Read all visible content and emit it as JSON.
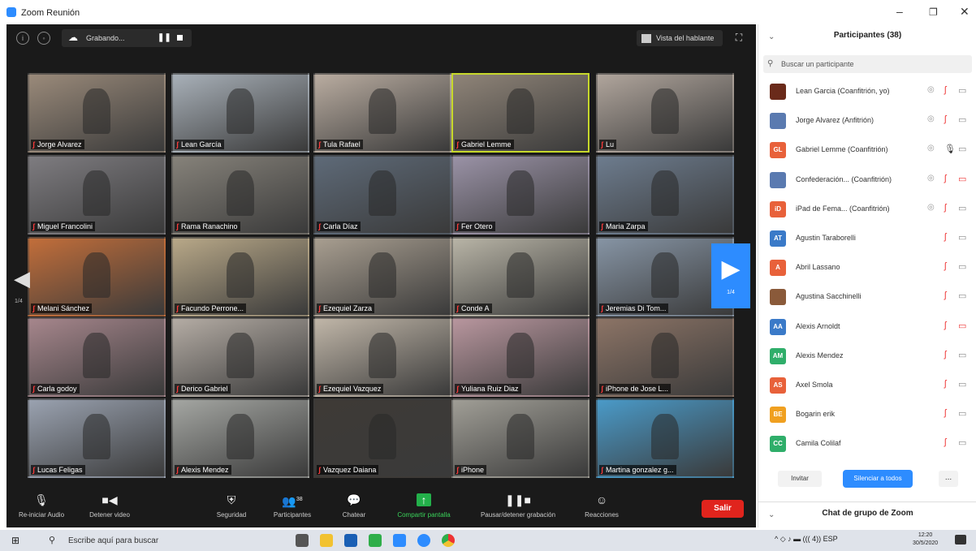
{
  "window": {
    "title": "Zoom Reunión",
    "controls": [
      "–",
      "❐",
      "✕"
    ]
  },
  "topbar": {
    "recording_label": "Grabando...",
    "speaker_view_label": "Vista del hablante"
  },
  "grid": {
    "page_left": "1/4",
    "page_right": "1/4",
    "tiles": [
      {
        "name": "Jorge Alvarez",
        "bg": "#9a8a7a",
        "active": false
      },
      {
        "name": "Lean García",
        "bg": "#a8b0b8",
        "active": false
      },
      {
        "name": "Tula Rafael",
        "bg": "#b9aca0",
        "active": false
      },
      {
        "name": "Gabriel Lemme",
        "bg": "#8f8478",
        "active": true
      },
      {
        "name": "Lu",
        "bg": "#b0a59c",
        "active": false
      },
      {
        "name": "Miguel Francolini",
        "bg": "#7e7c80",
        "active": false
      },
      {
        "name": "Rama Ranachino",
        "bg": "#86827a",
        "active": false
      },
      {
        "name": "Carla Díaz",
        "bg": "#5e6a78",
        "active": false
      },
      {
        "name": "Fer Otero",
        "bg": "#9a92a6",
        "active": false
      },
      {
        "name": "Maria Zarpa",
        "bg": "#6d7c8e",
        "active": false
      },
      {
        "name": "Melani Sánchez",
        "bg": "#c26e3a",
        "active": false
      },
      {
        "name": "Facundo Perrone...",
        "bg": "#b8a888",
        "active": false
      },
      {
        "name": "Ezequiel Zarza",
        "bg": "#a89e90",
        "active": false
      },
      {
        "name": "Conde A",
        "bg": "#b8b4a6",
        "active": false
      },
      {
        "name": "Jeremias Di Tom...",
        "bg": "#8694a4",
        "active": false
      },
      {
        "name": "Carla godoy",
        "bg": "#a6868c",
        "active": false
      },
      {
        "name": "Derico Gabriel",
        "bg": "#b4aca4",
        "active": false
      },
      {
        "name": "Ezequiel Vazquez",
        "bg": "#c0b6a8",
        "active": false
      },
      {
        "name": "Yuliana Ruiz Diaz",
        "bg": "#b8969e",
        "active": false
      },
      {
        "name": "iPhone de Jose L...",
        "bg": "#8c7466",
        "active": false
      },
      {
        "name": "Lucas Feligas",
        "bg": "#9aa2b0",
        "active": false
      },
      {
        "name": "Alexis Mendez",
        "bg": "#a4a6a2",
        "active": false
      },
      {
        "name": "Vazquez Daiana",
        "bg": "#3e3a36",
        "active": false
      },
      {
        "name": "iPhone",
        "bg": "#a09e96",
        "active": false
      },
      {
        "name": "Martina gonzalez g...",
        "bg": "#4a9ac8",
        "active": false
      }
    ]
  },
  "toolbar": {
    "items": [
      {
        "label": "Re-iniciar Audio",
        "icon": "🎙"
      },
      {
        "label": "Detener video",
        "icon": "■◀"
      },
      {
        "label": "Seguridad",
        "icon": "⛨"
      },
      {
        "label": "Participantes",
        "icon": "👥"
      },
      {
        "label": "Chatear",
        "icon": "💬"
      },
      {
        "label": "Compartir pantalla",
        "icon": "↑"
      },
      {
        "label": "Pausar/detener grabación",
        "icon": "❚❚■"
      },
      {
        "label": "Reacciones",
        "icon": "☺"
      }
    ],
    "participants_count": "38",
    "leave_label": "Salir"
  },
  "panel": {
    "title": "Participantes (38)",
    "search_placeholder": "Buscar un participante",
    "participants": [
      {
        "name": "Lean Garcia (Coanfitrión, yo)",
        "initials": "",
        "color": "#6a2a1a",
        "mic": "muted",
        "video": "off",
        "eye": true
      },
      {
        "name": "Jorge Alvarez (Anfitrión)",
        "initials": "",
        "color": "#5a7ab0",
        "mic": "muted",
        "video": "off",
        "eye": true
      },
      {
        "name": "Gabriel Lemme (Coanfitrión)",
        "initials": "GL",
        "color": "#e8613a",
        "mic": "on",
        "video": "off",
        "eye": true
      },
      {
        "name": "Confederación... (Coanfitrión)",
        "initials": "",
        "color": "#5a7ab0",
        "mic": "muted",
        "video": "red",
        "eye": true
      },
      {
        "name": "iPad de Fema... (Coanfitrión)",
        "initials": "iD",
        "color": "#e8613a",
        "mic": "muted",
        "video": "off",
        "eye": true
      },
      {
        "name": "Agustin Taraborelli",
        "initials": "AT",
        "color": "#3a7ac8",
        "mic": "muted",
        "video": "off",
        "eye": false
      },
      {
        "name": "Abril Lassano",
        "initials": "A",
        "color": "#e8613a",
        "mic": "muted",
        "video": "off",
        "eye": false
      },
      {
        "name": "Agustina Sacchinelli",
        "initials": "",
        "color": "#8a5a3a",
        "mic": "muted",
        "video": "off",
        "eye": false
      },
      {
        "name": "Alexis Arnoldt",
        "initials": "AA",
        "color": "#3a7ac8",
        "mic": "muted",
        "video": "red",
        "eye": false
      },
      {
        "name": "Alexis Mendez",
        "initials": "AM",
        "color": "#2fae6a",
        "mic": "muted",
        "video": "off",
        "eye": false
      },
      {
        "name": "Axel Smola",
        "initials": "AS",
        "color": "#e8613a",
        "mic": "muted",
        "video": "off",
        "eye": false
      },
      {
        "name": "Bogarin erik",
        "initials": "BE",
        "color": "#f0a020",
        "mic": "muted",
        "video": "off",
        "eye": false
      },
      {
        "name": "Camila Colilaf",
        "initials": "CC",
        "color": "#2fae6a",
        "mic": "muted",
        "video": "off",
        "eye": false
      }
    ],
    "invite_label": "Invitar",
    "mute_all_label": "Silenciar a todos",
    "more_label": "...",
    "chat_title": "Chat de grupo de Zoom"
  },
  "taskbar": {
    "search_placeholder": "Escribe aquí para buscar",
    "tray_text": "^ ◇ ♪ ▬ ((( 4)) ESP",
    "time": "12:20",
    "date": "30/5/2020"
  }
}
